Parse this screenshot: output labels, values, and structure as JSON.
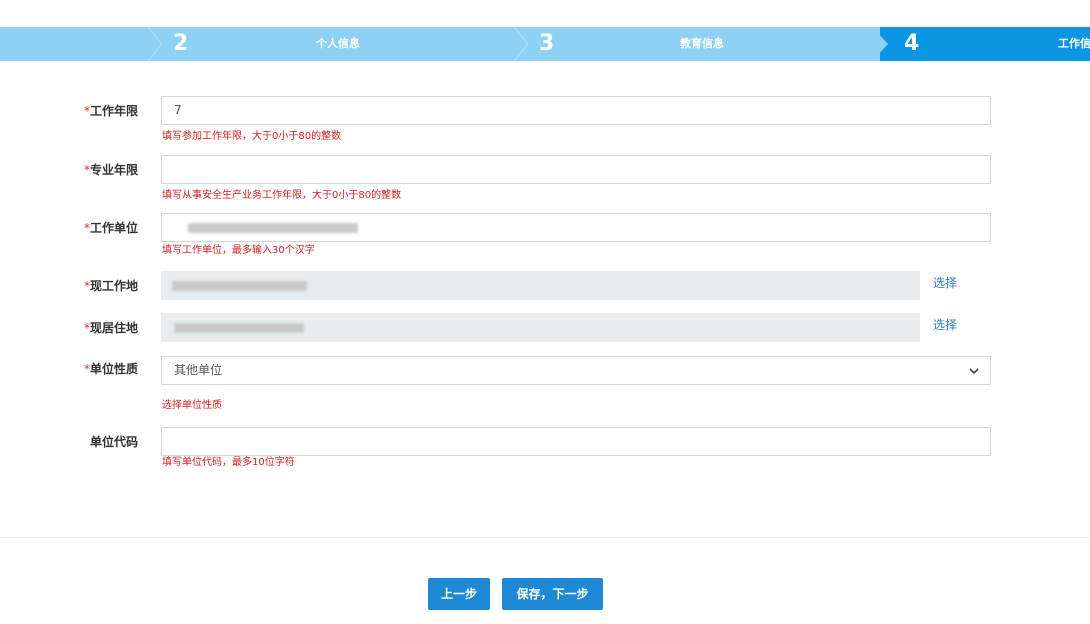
{
  "steps": [
    {
      "number": "2",
      "label": "个人信息"
    },
    {
      "number": "3",
      "label": "教育信息"
    },
    {
      "number": "4",
      "label": "工作信",
      "active": true
    }
  ],
  "form": {
    "required_mark": "*",
    "work_years": {
      "label": "工作年限",
      "value": "7",
      "hint": "填写参加工作年限，大于0小于80的整数"
    },
    "professional_years": {
      "label": "专业年限",
      "value": "",
      "hint": "填写从事安全生产业务工作年限，大于0小于80的整数"
    },
    "employer": {
      "label": "工作单位",
      "hint": "填写工作单位，最多输入30个汉字"
    },
    "work_location": {
      "label": "现工作地",
      "choose": "选择"
    },
    "residence": {
      "label": "现居住地",
      "choose": "选择"
    },
    "unit_type": {
      "label": "单位性质",
      "selected": "其他单位",
      "hint": "选择单位性质"
    },
    "unit_code": {
      "label": "单位代码",
      "value": "",
      "hint": "填写单位代码，最多10位字符"
    }
  },
  "buttons": {
    "prev": "上一步",
    "save_next": "保存，下一步"
  },
  "colors": {
    "step_bar": "#8fd0f5",
    "step_active": "#0b95e2",
    "hint": "#d42020",
    "button": "#1e88d4",
    "link": "#2a7fd4"
  }
}
